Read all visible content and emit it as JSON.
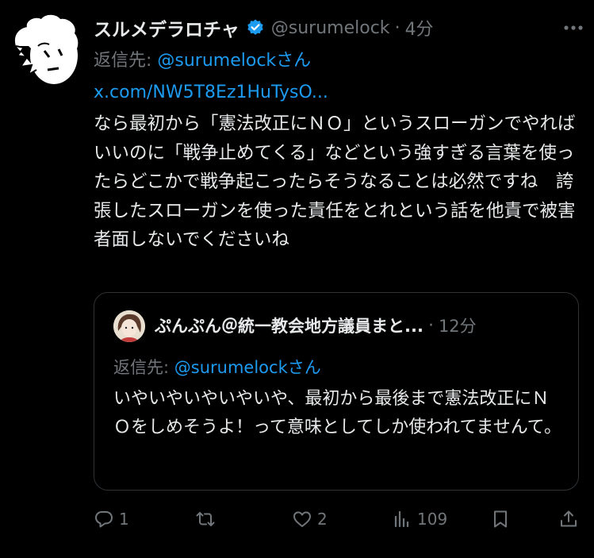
{
  "tweet": {
    "display_name": "スルメデラロチャ",
    "handle": "@surumelock",
    "separator": "·",
    "time": "4分",
    "reply_prefix": "返信先: ",
    "reply_mention": "@surumelockさん",
    "link": "x.com/NW5T8Ez1HuTysO...",
    "text": "なら最初から「憲法改正にＮＯ」というスローガンでやればいいのに「戦争止めてくる」などという強すぎる言葉を使ったらどこかで戦争起こったらそうなることは必然ですね　誇張したスローガンを使った責任をとれという話を他責で被害者面しないでくださいね"
  },
  "quote": {
    "display_name": "ぷんぷん＠統一教会地方議員まと...",
    "separator": "·",
    "time": "12分",
    "reply_prefix": "返信先: ",
    "reply_mention": "@surumelockさん",
    "text": "いやいやいやいやいや、最初から最後まで憲法改正にＮＯをしめそうよ！って意味としてしか使われてませんて。"
  },
  "actions": {
    "reply_count": "1",
    "retweet_count": "",
    "like_count": "2",
    "views_count": "109"
  },
  "icons": {
    "verified": "verified-badge-icon",
    "more": "more-icon",
    "reply": "reply-icon",
    "retweet": "retweet-icon",
    "like": "heart-icon",
    "views": "views-icon",
    "bookmark": "bookmark-icon",
    "share": "share-icon"
  },
  "colors": {
    "background": "#000000",
    "text": "#e7e9ea",
    "muted": "#71767b",
    "accent": "#1d9bf0",
    "border": "#2f3336"
  }
}
